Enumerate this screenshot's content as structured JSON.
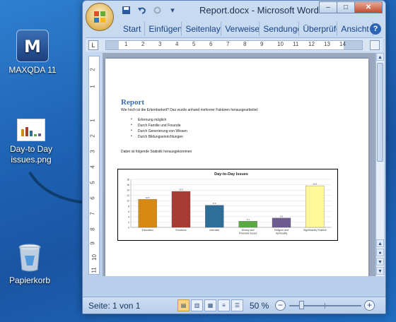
{
  "desktop": {
    "icons": [
      {
        "label": "MAXQDA 11",
        "icon": "maxqda-icon"
      },
      {
        "label": "Day-to Day issues.png",
        "icon": "image-file-icon"
      },
      {
        "label": "Papierkorb",
        "icon": "recycle-bin-icon"
      }
    ],
    "maxqda_glyph": "M"
  },
  "window": {
    "title": "Report.docx - Microsoft Word",
    "controls": {
      "minimize": "–",
      "maximize": "□",
      "close": "✕"
    },
    "qat": {
      "save": "save-icon",
      "undo": "undo-icon",
      "redo": "redo-icon",
      "more": "▾"
    },
    "tabs": [
      "Start",
      "Einfügen",
      "Seitenlayout",
      "Verweise",
      "Sendungen",
      "Überprüfen",
      "Ansicht"
    ],
    "help": "?"
  },
  "ruler": {
    "horizontal_ticks": [
      "1",
      "2",
      "3",
      "4",
      "5",
      "6",
      "7",
      "8",
      "9",
      "10",
      "11",
      "12",
      "13",
      "14"
    ],
    "vertical_ticks": [
      "2",
      "1",
      "1",
      "2",
      "3",
      "4",
      "5",
      "6",
      "7",
      "8",
      "9",
      "10",
      "11"
    ],
    "tab_selector": "L"
  },
  "document": {
    "title": "Report",
    "intro": "Wie hoch ist die Erlernbarkeit? Das wurde anhand mehrerer Faktoren herausgearbeitet:",
    "bullets": [
      "Erlernung möglich",
      "Durch Familie und Freunde",
      "Durch Generierung von Wissen",
      "Durch Bildungseinrichtungen"
    ],
    "outro": "Dabei ist folgende Statistik herausgekommen"
  },
  "chart_data": {
    "type": "bar",
    "title": "Day-to-Day Issues",
    "categories": [
      "Education",
      "Emotions",
      "Interests",
      "Money and Financial Issues",
      "Religion and Spirituality",
      "Significantly Positive"
    ],
    "values": [
      10.5,
      13.5,
      8.3,
      2.3,
      3.5,
      15.6
    ],
    "colors": [
      "#d78a12",
      "#a83b32",
      "#2f6e96",
      "#5aaa42",
      "#6d5a8e",
      "#fff79a"
    ],
    "ylim": [
      0,
      18
    ],
    "y_ticks": [
      "0",
      "2",
      "4",
      "6",
      "8",
      "10",
      "12",
      "14",
      "16",
      "18"
    ],
    "grid": true
  },
  "statusbar": {
    "page": "Seite: 1 von 1",
    "zoom": "50 %",
    "zoom_level": 50,
    "view_buttons": [
      "print-layout-icon",
      "full-screen-reading-icon",
      "web-layout-icon",
      "outline-icon",
      "draft-icon"
    ]
  }
}
